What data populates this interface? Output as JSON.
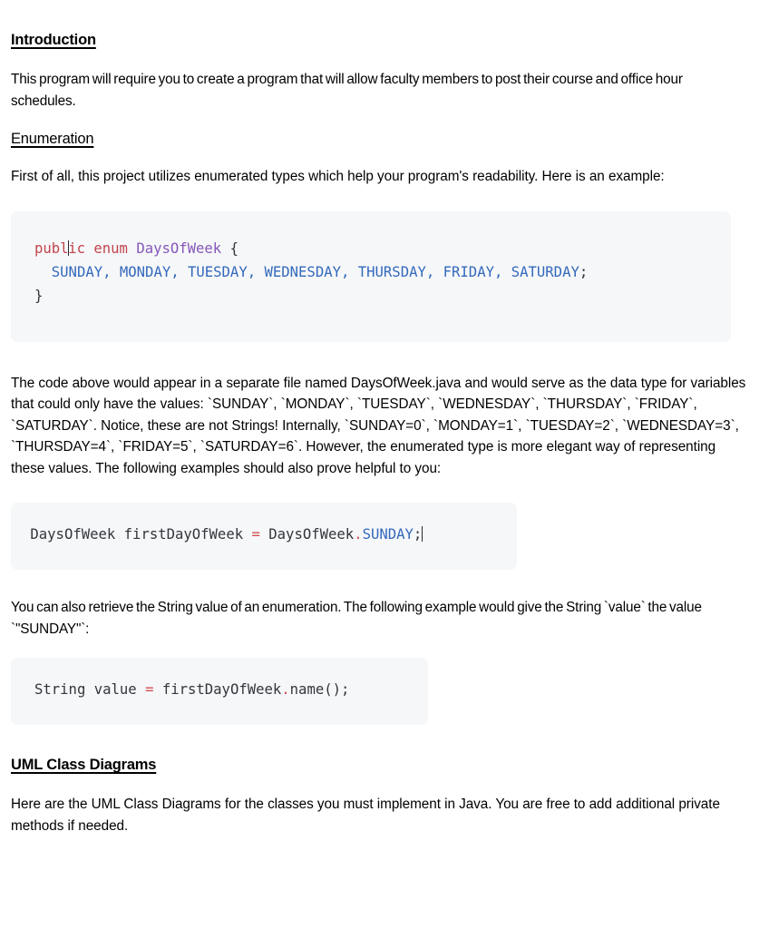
{
  "document": {
    "sections": [
      {
        "id": "introduction",
        "heading": "Introduction",
        "heading_style": "bold-underline",
        "paragraph": "This program will require you to create a program that will allow faculty members to post their course and office hour schedules."
      },
      {
        "id": "enumeration",
        "heading": "Enumeration",
        "heading_style": "underline",
        "paragraph": "First of all, this project utilizes enumerated types which help your program's readability. Here is an example:"
      },
      {
        "id": "uml-class-diagrams",
        "heading": "UML Class Diagrams",
        "heading_style": "bold-underline",
        "paragraph": "Here are the UML Class Diagrams for the classes you must implement in Java. You are free to add additional private methods if needed."
      }
    ],
    "paragraphs": {
      "after_enum_block": "The code above would appear in a separate file named DaysOfWeek.java and would serve as the data type for variables that could only have the values: `SUNDAY`, `MONDAY`, `TUESDAY`, `WEDNESDAY`, `THURSDAY`, `FRIDAY`, `SATURDAY`. Notice, these are not Strings! Internally, `SUNDAY=0`, `MONDAY=1`, `TUESDAY=2`, `WEDNESDAY=3`, `THURSDAY=4`, `FRIDAY=5`, `SATURDAY=6`. However, the enumerated type is more elegant way of representing these values. The following examples should also prove helpful to you:",
      "after_decl_block": "You can also retrieve the String value of an enumeration. The following example would give the String `value` the value `\"SUNDAY\"`:"
    },
    "code_blocks": {
      "enum_declaration": {
        "language": "java",
        "full_text": "public enum DaysOfWeek {\n   SUNDAY, MONDAY, TUESDAY, WEDNESDAY, THURSDAY, FRIDAY, SATURDAY;\n}",
        "tokens_line1": {
          "keyword_public": "public",
          "keyword_enum": "enum",
          "type_name": "DaysOfWeek",
          "brace_open": "{"
        },
        "tokens_line2": {
          "constants": "SUNDAY, MONDAY, TUESDAY, WEDNESDAY, THURSDAY, FRIDAY, SATURDAY",
          "semicolon": ";"
        },
        "tokens_line3": {
          "brace_close": "}"
        },
        "has_caret": true
      },
      "variable_declaration": {
        "language": "java",
        "full_text": "DaysOfWeek firstDayOfWeek = DaysOfWeek.SUNDAY;",
        "tokens": {
          "decl_type_and_name": "DaysOfWeek firstDayOfWeek ",
          "operator_assign": "=",
          "qualifier": " DaysOfWeek",
          "operator_dot": ".",
          "constant": "SUNDAY",
          "semicolon": ";"
        },
        "has_caret": true
      },
      "name_method": {
        "language": "java",
        "full_text": "String value = firstDayOfWeek.name();",
        "tokens": {
          "decl_type_and_name": "String value ",
          "operator_assign": "=",
          "variable": " firstDayOfWeek",
          "operator_dot": ".",
          "method_call": "name();"
        },
        "has_caret": false
      }
    },
    "colors": {
      "code_background": "#f6f7f9",
      "keyword": "#c2444c",
      "type": "#8558b8",
      "constant": "#3369bb",
      "operator": "#d24c50",
      "code_text": "#32363c",
      "body_text": "#000000",
      "page_background": "#ffffff"
    }
  }
}
